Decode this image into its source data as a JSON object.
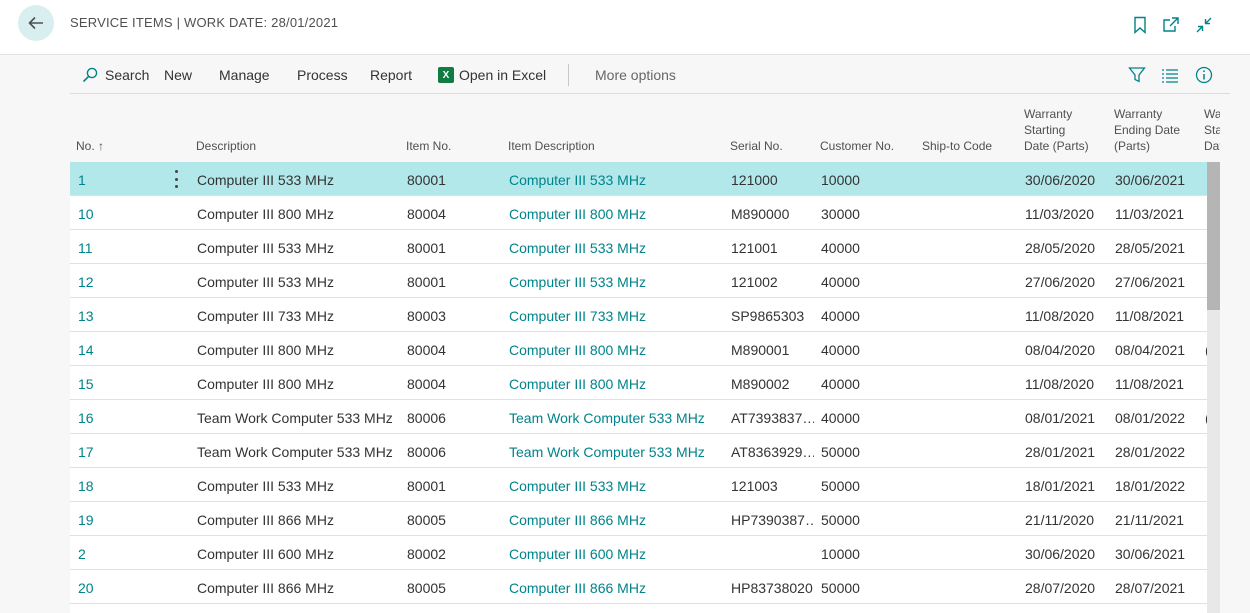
{
  "header": {
    "title": "SERVICE ITEMS | WORK DATE: 28/01/2021"
  },
  "actions": {
    "search": "Search",
    "new": "New",
    "manage": "Manage",
    "process": "Process",
    "report": "Report",
    "open_in_excel": "Open in Excel",
    "more_options": "More options"
  },
  "columns": {
    "no": "No. ↑",
    "description": "Description",
    "item_no": "Item No.",
    "item_description": "Item Description",
    "serial_no": "Serial No.",
    "customer_no": "Customer No.",
    "ship_to_code": "Ship-to Code",
    "warranty_start_l1": "Warranty",
    "warranty_start_l2": "Starting",
    "warranty_start_l3": "Date (Parts)",
    "warranty_end_l1": "Warranty",
    "warranty_end_l2": "Ending Date",
    "warranty_end_l3": "(Parts)",
    "cut_l1": "Wa",
    "cut_l2": "Sta",
    "cut_l3": "Dat"
  },
  "rows": [
    {
      "no": "1",
      "description": "Computer III 533 MHz",
      "item_no": "80001",
      "item_description": "Computer III 533 MHz",
      "serial_no": "121000",
      "customer_no": "10000",
      "ship_to_code": "",
      "warranty_start": "30/06/2020",
      "warranty_end": "30/06/2021",
      "cut": ""
    },
    {
      "no": "10",
      "description": "Computer III 800 MHz",
      "item_no": "80004",
      "item_description": "Computer III 800 MHz",
      "serial_no": "M890000",
      "customer_no": "30000",
      "ship_to_code": "",
      "warranty_start": "11/03/2020",
      "warranty_end": "11/03/2021",
      "cut": ""
    },
    {
      "no": "11",
      "description": "Computer III 533 MHz",
      "item_no": "80001",
      "item_description": "Computer III 533 MHz",
      "serial_no": "121001",
      "customer_no": "40000",
      "ship_to_code": "",
      "warranty_start": "28/05/2020",
      "warranty_end": "28/05/2021",
      "cut": ""
    },
    {
      "no": "12",
      "description": "Computer III 533 MHz",
      "item_no": "80001",
      "item_description": "Computer III 533 MHz",
      "serial_no": "121002",
      "customer_no": "40000",
      "ship_to_code": "",
      "warranty_start": "27/06/2020",
      "warranty_end": "27/06/2021",
      "cut": ""
    },
    {
      "no": "13",
      "description": "Computer III 733 MHz",
      "item_no": "80003",
      "item_description": "Computer III 733 MHz",
      "serial_no": "SP9865303",
      "customer_no": "40000",
      "ship_to_code": "",
      "warranty_start": "11/08/2020",
      "warranty_end": "11/08/2021",
      "cut": ""
    },
    {
      "no": "14",
      "description": "Computer III 800 MHz",
      "item_no": "80004",
      "item_description": "Computer III 800 MHz",
      "serial_no": "M890001",
      "customer_no": "40000",
      "ship_to_code": "",
      "warranty_start": "08/04/2020",
      "warranty_end": "08/04/2021",
      "cut": "("
    },
    {
      "no": "15",
      "description": "Computer III 800 MHz",
      "item_no": "80004",
      "item_description": "Computer III 800 MHz",
      "serial_no": "M890002",
      "customer_no": "40000",
      "ship_to_code": "",
      "warranty_start": "11/08/2020",
      "warranty_end": "11/08/2021",
      "cut": ""
    },
    {
      "no": "16",
      "description": "Team Work Computer 533 MHz",
      "item_no": "80006",
      "item_description": "Team Work Computer 533 MHz",
      "serial_no": "AT7393837…",
      "customer_no": "40000",
      "ship_to_code": "",
      "warranty_start": "08/01/2021",
      "warranty_end": "08/01/2022",
      "cut": "("
    },
    {
      "no": "17",
      "description": "Team Work Computer 533 MHz",
      "item_no": "80006",
      "item_description": "Team Work Computer 533 MHz",
      "serial_no": "AT8363929…",
      "customer_no": "50000",
      "ship_to_code": "",
      "warranty_start": "28/01/2021",
      "warranty_end": "28/01/2022",
      "cut": ""
    },
    {
      "no": "18",
      "description": "Computer III 533 MHz",
      "item_no": "80001",
      "item_description": "Computer III 533 MHz",
      "serial_no": "121003",
      "customer_no": "50000",
      "ship_to_code": "",
      "warranty_start": "18/01/2021",
      "warranty_end": "18/01/2022",
      "cut": ""
    },
    {
      "no": "19",
      "description": "Computer III 866 MHz",
      "item_no": "80005",
      "item_description": "Computer III 866 MHz",
      "serial_no": "HP7390387…",
      "customer_no": "50000",
      "ship_to_code": "",
      "warranty_start": "21/11/2020",
      "warranty_end": "21/11/2021",
      "cut": ""
    },
    {
      "no": "2",
      "description": "Computer III 600 MHz",
      "item_no": "80002",
      "item_description": "Computer III 600 MHz",
      "serial_no": "",
      "customer_no": "10000",
      "ship_to_code": "",
      "warranty_start": "30/06/2020",
      "warranty_end": "30/06/2021",
      "cut": ""
    },
    {
      "no": "20",
      "description": "Computer III 866 MHz",
      "item_no": "80005",
      "item_description": "Computer III 866 MHz",
      "serial_no": "HP83738020",
      "customer_no": "50000",
      "ship_to_code": "",
      "warranty_start": "28/07/2020",
      "warranty_end": "28/07/2021",
      "cut": ""
    }
  ],
  "colors": {
    "accent": "#00838a",
    "selected_row": "#b2e8ea",
    "back_button_bg": "#d9eeef"
  },
  "icons": [
    "back-arrow-icon",
    "bookmark-icon",
    "open-new-window-icon",
    "collapse-icon",
    "search-icon",
    "excel-icon",
    "filter-icon",
    "list-view-icon",
    "info-icon",
    "row-actions-icon"
  ]
}
